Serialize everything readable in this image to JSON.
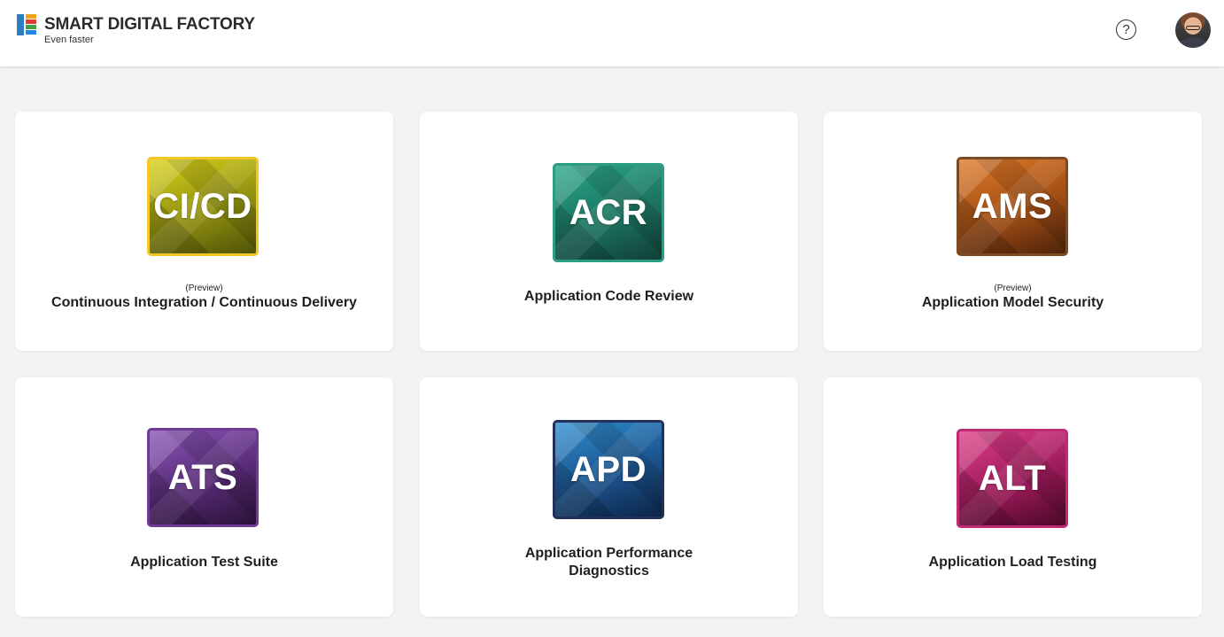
{
  "header": {
    "brand_title": "SMART DIGITAL FACTORY",
    "brand_subtitle": "Even faster",
    "brand_colors": [
      "#2f7cc1",
      "#f2a71b",
      "#e53935",
      "#43a047",
      "#1e88e5"
    ],
    "help_icon": "help-circle-icon",
    "help_glyph": "?",
    "avatar_icon": "user-avatar"
  },
  "cards": [
    {
      "tile_label": "CI/CD",
      "preview": "(Preview)",
      "title": "Continuous Integration / Continuous Delivery",
      "accent": "#f3c623"
    },
    {
      "tile_label": "ACR",
      "preview": "",
      "title": "Application Code Review",
      "accent": "#2b9d80"
    },
    {
      "tile_label": "AMS",
      "preview": "(Preview)",
      "title": "Application Model Security",
      "accent": "#7d4a22"
    },
    {
      "tile_label": "ATS",
      "preview": "",
      "title": "Application Test Suite",
      "accent": "#6e3a95"
    },
    {
      "tile_label": "APD",
      "preview": "",
      "title_line1": "Application Performance",
      "title_line2": "Diagnostics",
      "accent": "#23305a"
    },
    {
      "tile_label": "ALT",
      "preview": "",
      "title": "Application Load Testing",
      "accent": "#c02a72"
    }
  ]
}
